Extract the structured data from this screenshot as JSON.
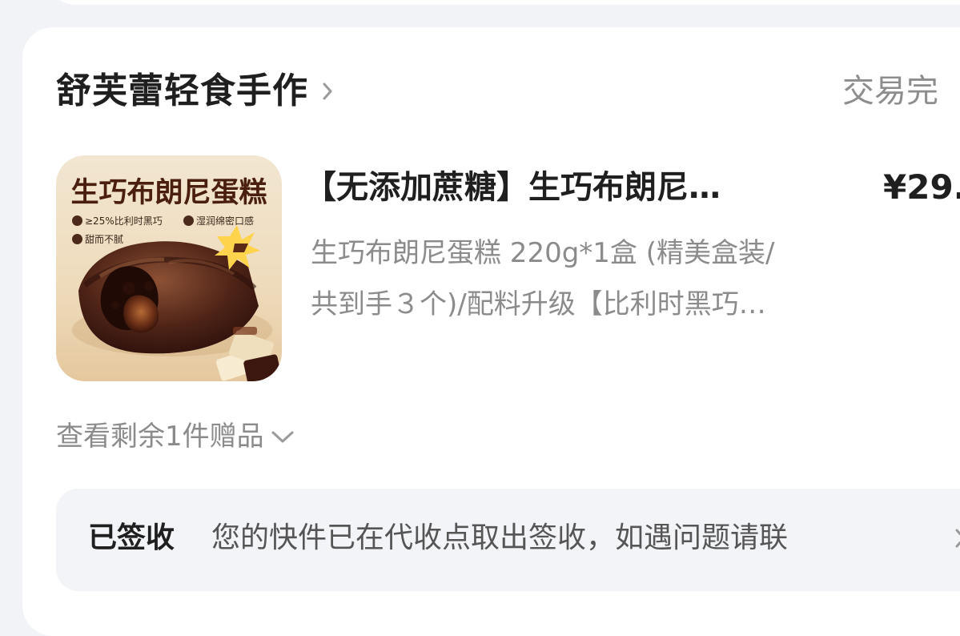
{
  "store": {
    "name": "舒芙蕾轻食手作",
    "chevron_icon": "chevron-right-icon"
  },
  "order": {
    "status": "交易完"
  },
  "product": {
    "thumbnail": {
      "title": "生巧布朗尼蛋糕",
      "features": [
        "≥25%比利时黑巧",
        "湿润绵密口感",
        "甜而不腻"
      ]
    },
    "name": "【无添加蔗糖】生巧布朗尼…",
    "price": "¥29.",
    "spec_line_1": "生巧布朗尼蛋糕 220g*1盒 (精美盒装/",
    "spec_line_2": "共到手３个)/配料升级【比利时黑巧…"
  },
  "gifts": {
    "label": "查看剩余1件赠品",
    "chevron_icon": "chevron-down-icon"
  },
  "delivery": {
    "status": "已签收",
    "message": "您的快件已在代收点取出签收，如遇问题请联",
    "chevron_icon": "chevron-right-icon"
  },
  "colors": {
    "page_background": "#f2f3f7",
    "card_background": "#ffffff",
    "muted_text": "#8b8b8b",
    "primary_text": "#1f1f1f",
    "delivery_background": "#f3f4f8"
  }
}
